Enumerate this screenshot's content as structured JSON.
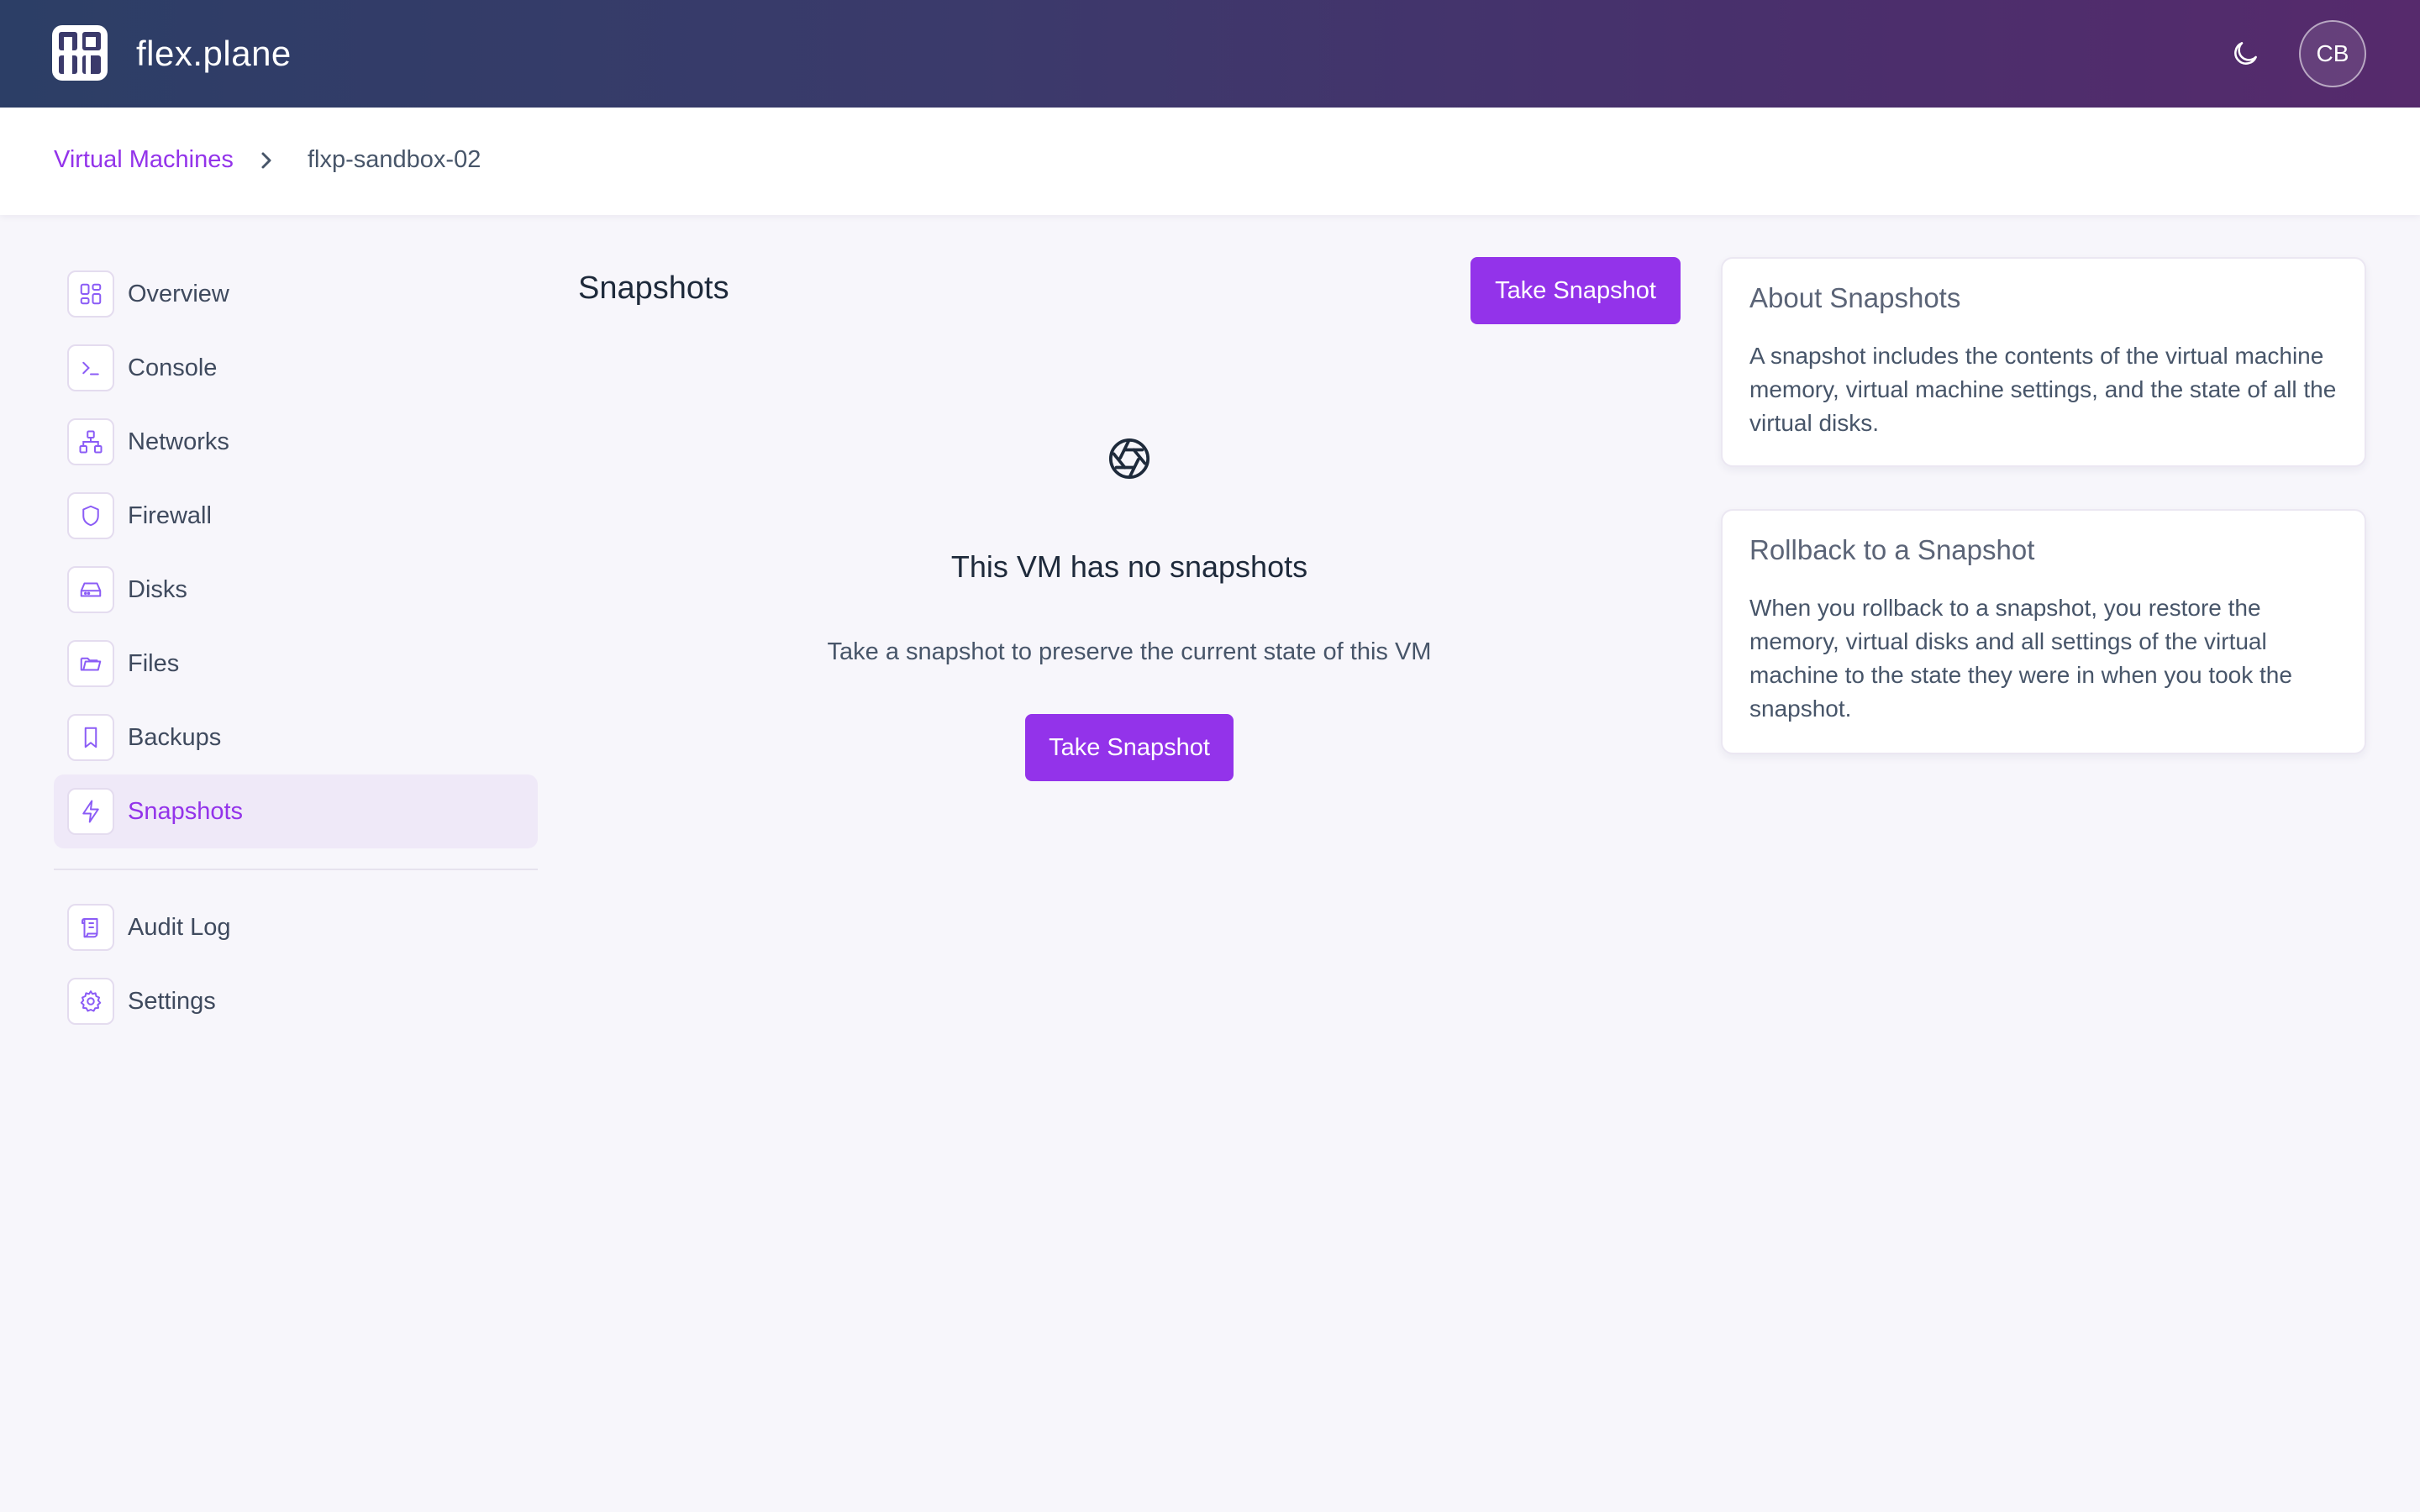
{
  "header": {
    "brand": "flex.plane",
    "avatar_initials": "CB",
    "theme_icon": "moon-icon",
    "logo_icon": "flexplane-logo"
  },
  "breadcrumb": {
    "parent": "Virtual Machines",
    "current": "flxp-sandbox-02"
  },
  "sidebar": {
    "items": [
      {
        "label": "Overview",
        "icon": "grid-icon"
      },
      {
        "label": "Console",
        "icon": "terminal-icon"
      },
      {
        "label": "Networks",
        "icon": "network-icon"
      },
      {
        "label": "Firewall",
        "icon": "shield-icon"
      },
      {
        "label": "Disks",
        "icon": "hard-drive-icon"
      },
      {
        "label": "Files",
        "icon": "folder-icon"
      },
      {
        "label": "Backups",
        "icon": "bookmark-icon"
      },
      {
        "label": "Snapshots",
        "icon": "lightning-icon",
        "active": true
      }
    ],
    "secondary": [
      {
        "label": "Audit Log",
        "icon": "scroll-icon"
      },
      {
        "label": "Settings",
        "icon": "gear-icon"
      }
    ]
  },
  "main": {
    "title": "Snapshots",
    "take_snapshot_label": "Take Snapshot",
    "empty_state": {
      "icon": "aperture-icon",
      "title": "This VM has no snapshots",
      "subtitle": "Take a snapshot to preserve the current state of this VM",
      "button_label": "Take Snapshot"
    }
  },
  "info_cards": [
    {
      "title": "About Snapshots",
      "body": "A snapshot includes the contents of the virtual machine memory, virtual machine settings, and the state of all the virtual disks."
    },
    {
      "title": "Rollback to a Snapshot",
      "body": "When you rollback to a snapshot, you restore the memory, virtual disks and all settings of the virtual machine to the state they were in when you took the snapshot."
    }
  ],
  "colors": {
    "accent": "#9333ea",
    "header_start": "#2c3e66",
    "header_end": "#562a6c",
    "page_bg": "#f7f6fb"
  }
}
